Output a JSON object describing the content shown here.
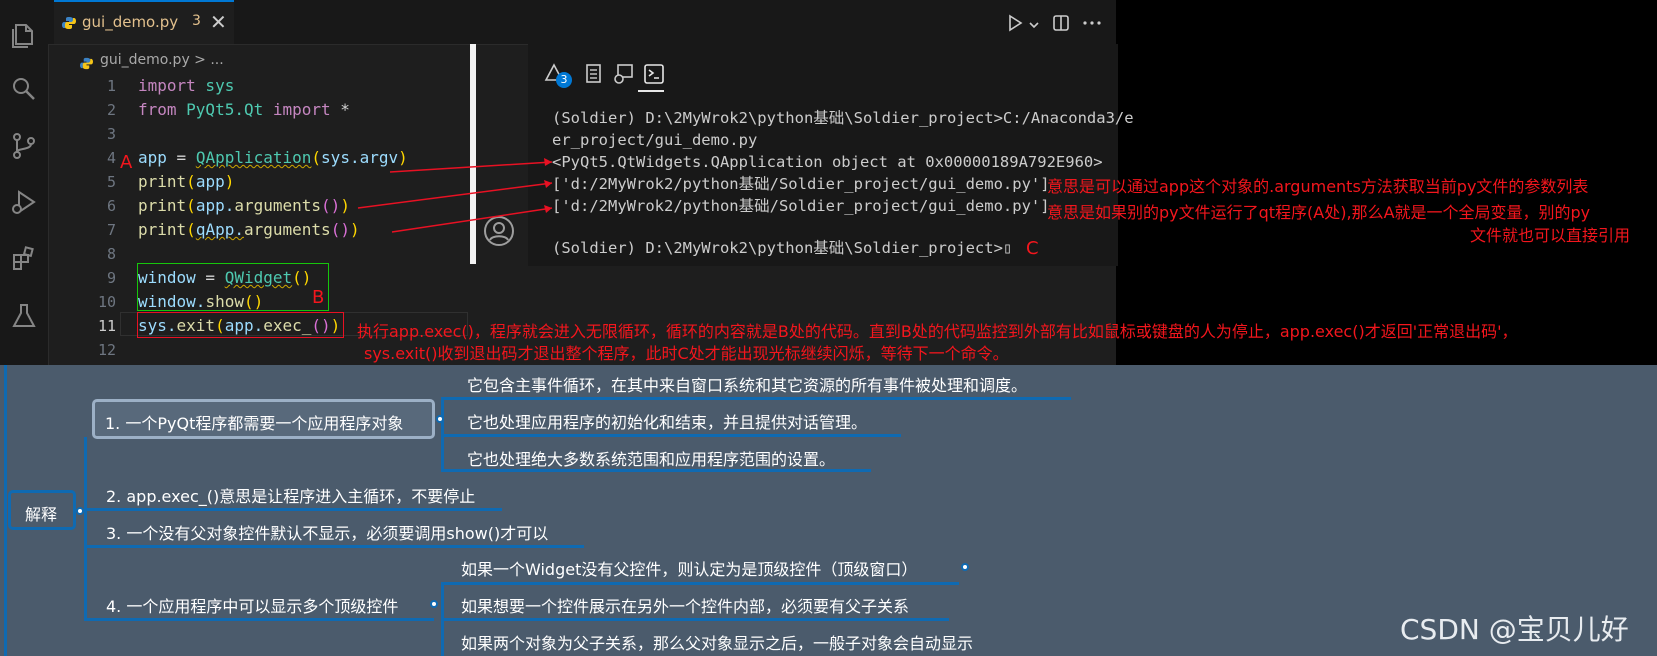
{
  "editor": {
    "tab_file": "gui_demo.py",
    "tab_badge": "3",
    "tab_close": "✕",
    "breadcrumb": "gui_demo.py > ...",
    "line_numbers": [
      "1",
      "2",
      "3",
      "4",
      "5",
      "6",
      "7",
      "8",
      "9",
      "10",
      "11",
      "12"
    ],
    "code": {
      "l1_kw": "import",
      "l1_mod": " sys",
      "l2_kw1": "from",
      "l2_mod": " PyQt5.Qt ",
      "l2_kw2": "import",
      "l2_star": " *",
      "l4_a": "app",
      "l4_eq": " = ",
      "l4_cls": "QApplication",
      "l4_p1": "(",
      "l4_arg": "sys.argv",
      "l4_p2": ")",
      "l5_fn": "print",
      "l5_p1": "(",
      "l5_arg": "app",
      "l5_p2": ")",
      "l6_fn": "print",
      "l6_p1": "(",
      "l6_arg": "app.",
      "l6_m": "arguments",
      "l6_pp": "()",
      "l6_p2": ")",
      "l7_fn": "print",
      "l7_p1": "(",
      "l7_arg": "qApp.",
      "l7_m": "arguments",
      "l7_pp": "()",
      "l7_p2": ")",
      "l9_a": "window",
      "l9_eq": " = ",
      "l9_cls": "QWidget",
      "l9_pp": "()",
      "l10_a": "window.",
      "l10_m": "show",
      "l10_pp": "()",
      "l11_a": "sys.",
      "l11_m": "exit",
      "l11_p1": "(",
      "l11_b": "app.",
      "l11_m2": "exec_",
      "l11_pp": "()",
      "l11_p2": ")"
    }
  },
  "terminal": {
    "badge": "3",
    "lines": [
      "(Soldier) D:\\2MyWrok2\\python基础\\Soldier_project>C:/Anaconda3/e",
      "er_project/gui_demo.py",
      "<PyQt5.QtWidgets.QApplication object at 0x00000189A792E960>",
      "['d:/2MyWrok2/python基础/Soldier_project/gui_demo.py']",
      "['d:/2MyWrok2/python基础/Soldier_project/gui_demo.py']",
      "",
      "(Soldier) D:\\2MyWrok2\\python基础\\Soldier_project>▯"
    ]
  },
  "annotations": {
    "label_a": "A",
    "label_b": "B",
    "label_c": "C",
    "note1": "意思是可以通过app这个对象的.arguments方法获取当前py文件的参数列表",
    "note2": "意思是如果别的py文件运行了qt程序(A处),那么A就是一个全局变量，别的py",
    "note2b": "文件就也可以直接引用",
    "note3": "执行app.exec()，程序就会进入无限循环，循环的内容就是B处的代码。直到B处的代码监控到外部有比如鼠标或键盘的人为停止，app.exec()才返回'正常退出码'，",
    "note3b": "sys.exit()收到退出码才退出整个程序，此时C处才能出现光标继续闪烁，等待下一个命令。"
  },
  "mindmap": {
    "root": "解释",
    "item1": "1. 一个PyQt程序都需要一个应用程序对象",
    "item1_sub": [
      "它包含主事件循环，在其中来自窗口系统和其它资源的所有事件被处理和调度。",
      "它也处理应用程序的初始化和结束，并且提供对话管理。",
      "它也处理绝大多数系统范围和应用程序范围的设置。"
    ],
    "item2": "2. app.exec_()意思是让程序进入主循环，不要停止",
    "item3": "3. 一个没有父对象控件默认不显示，必须要调用show()才可以",
    "item4": "4. 一个应用程序中可以显示多个顶级控件",
    "item4_sub": [
      "如果一个Widget没有父控件，则认定为是顶级控件（顶级窗口）",
      "如果想要一个控件展示在另外一个控件内部，必须要有父子关系",
      "如果两个对象为父子关系，那么父对象显示之后，一般子对象会自动显示"
    ]
  },
  "watermark": "CSDN @宝贝儿好",
  "colors": {
    "accent": "#0078d4",
    "annotation_red": "#f3161d",
    "annotation_green": "#16c60c",
    "mindmap_bg": "#4b5b6c",
    "mindmap_line": "#0f6ab2"
  }
}
